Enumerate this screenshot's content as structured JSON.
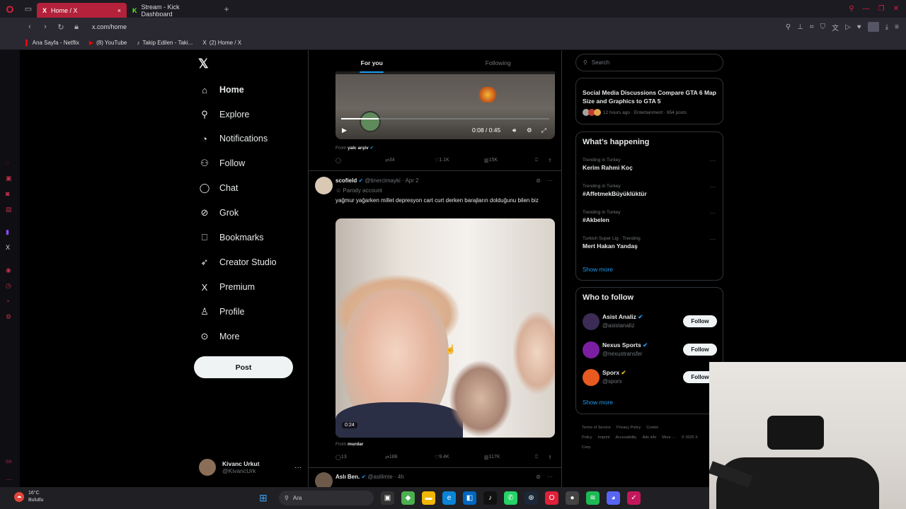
{
  "browser": {
    "tabs": [
      {
        "label": "Home / X",
        "icon": "x-logo-icon",
        "active": true
      },
      {
        "label": "Stream - Kick Dashboard",
        "icon": "kick-icon",
        "active": false
      }
    ],
    "url": "x.com/home",
    "bookmarks": [
      {
        "label": "Ana Sayfa - Netflix",
        "icon": "netflix-icon"
      },
      {
        "label": "(8) YouTube",
        "icon": "youtube-icon"
      },
      {
        "label": "Takip Edilen - Taki...",
        "icon": "tiktok-icon"
      },
      {
        "label": "(2) Home / X",
        "icon": "x-logo-icon"
      }
    ]
  },
  "nav": {
    "items": [
      {
        "label": "Home",
        "icon": "home-icon",
        "glyph": "⌂"
      },
      {
        "label": "Explore",
        "icon": "search-icon",
        "glyph": "⚲"
      },
      {
        "label": "Notifications",
        "icon": "bell-icon",
        "glyph": "◔"
      },
      {
        "label": "Follow",
        "icon": "add-person-icon",
        "glyph": "⚇"
      },
      {
        "label": "Chat",
        "icon": "chat-bubble-icon",
        "glyph": "◯"
      },
      {
        "label": "Grok",
        "icon": "grok-icon",
        "glyph": "⊘"
      },
      {
        "label": "Bookmarks",
        "icon": "bookmark-icon",
        "glyph": "⎕"
      },
      {
        "label": "Creator Studio",
        "icon": "rocket-icon",
        "glyph": "➶"
      },
      {
        "label": "Premium",
        "icon": "x-logo-icon",
        "glyph": "X"
      },
      {
        "label": "Profile",
        "icon": "person-icon",
        "glyph": "♙"
      },
      {
        "label": "More",
        "icon": "more-circle-icon",
        "glyph": "⊙"
      }
    ],
    "post_label": "Post",
    "user": {
      "name": "Kivanc Urkut",
      "handle": "@KivancUrk"
    }
  },
  "timeline": {
    "tabs": [
      "For you",
      "Following"
    ],
    "tweet1": {
      "video_time": "0:08 / 0:45",
      "from_prefix": "From",
      "from_name": "yalc arşiv",
      "replies": "",
      "retweets": "34",
      "likes": "1.1K",
      "views": "15K"
    },
    "tweet2": {
      "name": "scofield",
      "handle": "@tinercimayki",
      "date": "Apr 2",
      "parody": "Parody account",
      "text": "yağmur yağarken millet depresyon cart curt derken barajların dolduğunu bilen biz",
      "duration": "0:24",
      "from_prefix": "From",
      "from_name": "murdar",
      "replies": "13",
      "retweets": "188",
      "likes": "9.4K",
      "views": "117K"
    },
    "tweet3": {
      "name": "Aslı Ben.",
      "handle": "@aslilmte",
      "date": "4h"
    }
  },
  "sidebar": {
    "search_placeholder": "Search",
    "news": {
      "title": "Social Media Discussions Compare GTA 6 Map Size and Graphics to GTA 5",
      "meta": "12 hours ago · Entertainment · 654 posts"
    },
    "happening_title": "What’s happening",
    "trends": [
      {
        "context": "Trending in Turkey",
        "topic": "Kerim Rahmi Koç"
      },
      {
        "context": "Trending in Turkey",
        "topic": "#AffetmekBüyüklüktür"
      },
      {
        "context": "Trending in Turkey",
        "topic": "#Akbelen"
      },
      {
        "context": "Turkish Super Lig · Trending",
        "topic": "Mert Hakan Yandaş"
      }
    ],
    "show_more": "Show more",
    "who_title": "Who to follow",
    "who": [
      {
        "name": "Asist Analiz",
        "handle": "@asistanaliz",
        "button": "Follow",
        "color": "#3b2b55"
      },
      {
        "name": "Nexus Sports",
        "handle": "@nexustransfer",
        "button": "Follow",
        "color": "#7b1fa2"
      },
      {
        "name": "Sporx",
        "handle": "@sporx",
        "button": "Follow",
        "color": "#e85a1f"
      }
    ],
    "show_more_2": "Show more",
    "footer": [
      "Terms of Service",
      "Privacy Policy",
      "Cookie Policy",
      "Imprint",
      "Accessibility",
      "Ads info",
      "More ···",
      "© 2025 X Corp."
    ]
  },
  "taskbar": {
    "temp": "16°C",
    "weather": "Bulutlu",
    "search": "Ara"
  },
  "colors": {
    "accent": "#1d9bf0",
    "opera_red": "#e0203a"
  }
}
